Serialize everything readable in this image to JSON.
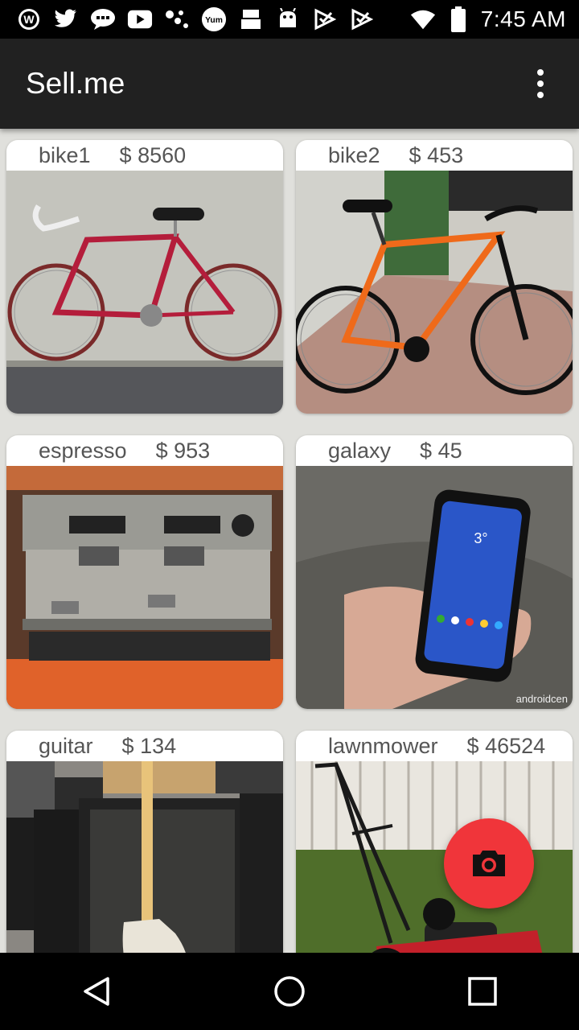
{
  "status_bar": {
    "time": "7:45 AM",
    "icons": [
      "wordpress-icon",
      "twitter-icon",
      "chat-icon",
      "youtube-icon",
      "dots-icon",
      "yum-icon",
      "toolbox-icon",
      "android-icon",
      "check-icon",
      "check-icon",
      "wifi-icon",
      "battery-icon"
    ]
  },
  "app_bar": {
    "title": "Sell.me",
    "overflow_icon": "more-vert-icon"
  },
  "listings": [
    {
      "name": "bike1",
      "price": "$ 8560"
    },
    {
      "name": "bike2",
      "price": "$ 453"
    },
    {
      "name": "espresso",
      "price": "$ 953"
    },
    {
      "name": "galaxy",
      "price": "$ 45"
    },
    {
      "name": "guitar",
      "price": "$ 134"
    },
    {
      "name": "lawnmower",
      "price": "$ 46524"
    }
  ],
  "galaxy_screen": {
    "clock": "3°",
    "watermark": "androidcen"
  },
  "fab": {
    "icon": "camera-icon",
    "color": "#f0353a"
  },
  "nav_bar": {
    "icons": [
      "back-icon",
      "home-icon",
      "recents-icon"
    ]
  },
  "colors": {
    "app_bar": "#212121",
    "background": "#e0e0dc"
  }
}
